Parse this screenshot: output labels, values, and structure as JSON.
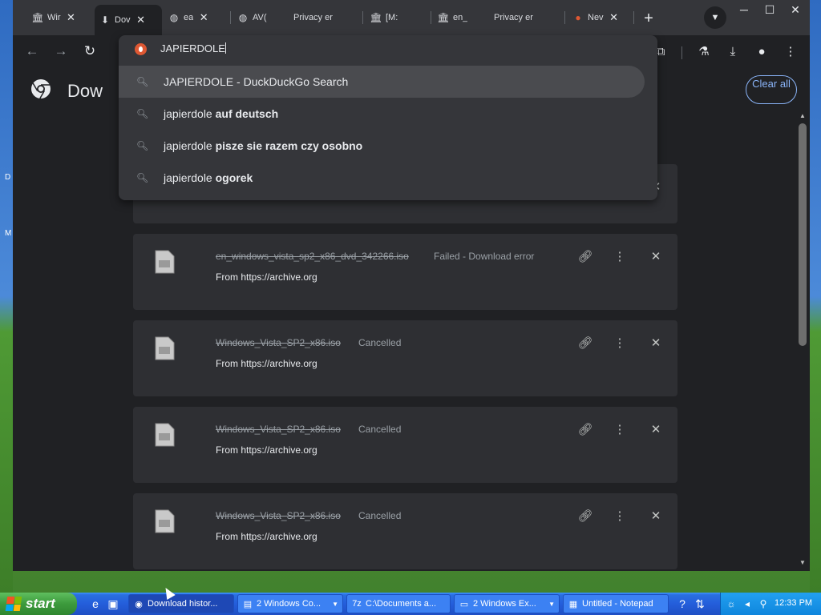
{
  "desktop": {
    "letters": [
      "D",
      "M"
    ]
  },
  "tabs": [
    {
      "title": "Wir",
      "icon": "archive-icon"
    },
    {
      "title": "Dov",
      "icon": "download-icon",
      "active": true
    },
    {
      "title": "ea",
      "icon": "globe-icon"
    },
    {
      "title": "AV(",
      "icon": "globe-icon"
    },
    {
      "title": "Privacy er",
      "icon": "none"
    },
    {
      "title": "[M:",
      "icon": "archive-icon"
    },
    {
      "title": "en_",
      "icon": "archive-icon"
    },
    {
      "title": "Privacy er",
      "icon": "none"
    },
    {
      "title": "Nev",
      "icon": "duckduckgo-icon"
    }
  ],
  "omnibox": {
    "value": "JAPIERDOLE",
    "suggestions": [
      {
        "plain": "JAPIERDOLE - DuckDuckGo Search",
        "bold": ""
      },
      {
        "plain": "japierdole ",
        "bold": "auf deutsch"
      },
      {
        "plain": "japierdole ",
        "bold": "pisze sie razem czy osobno"
      },
      {
        "plain": "japierdole ",
        "bold": "ogorek"
      }
    ]
  },
  "page": {
    "title": "Dow",
    "clear_all": "Clear all"
  },
  "downloads": [
    {
      "file": "en_windows_vista_sp2_x86_dvd_342266.iso",
      "status": "Failed - Download error",
      "source": "From https://archive.org"
    },
    {
      "file": "Windows_Vista_SP2_x86.iso",
      "status": "Cancelled",
      "source": "From https://archive.org"
    },
    {
      "file": "Windows_Vista_SP2_x86.iso",
      "status": "Cancelled",
      "source": "From https://archive.org"
    },
    {
      "file": "Windows_Vista_SP2_x86.iso",
      "status": "Cancelled",
      "source": "From https://archive.org"
    }
  ],
  "taskbar": {
    "start_label": "start",
    "tasks": [
      {
        "label": "Download histor...",
        "icon": "chrome-icon"
      },
      {
        "label": "2 Windows Co...",
        "icon": "console-icon"
      },
      {
        "label": "C:\\Documents a...",
        "icon": "7zip-icon"
      },
      {
        "label": "2 Windows Ex...",
        "icon": "folder-icon"
      },
      {
        "label": "Untitled - Notepad",
        "icon": "notepad-icon"
      }
    ],
    "clock": "12:33 PM"
  },
  "colors": {
    "accent": "#8ab4f8",
    "page_bg": "#202124",
    "card_bg": "#2e2f33",
    "taskbar": "#245edb"
  }
}
